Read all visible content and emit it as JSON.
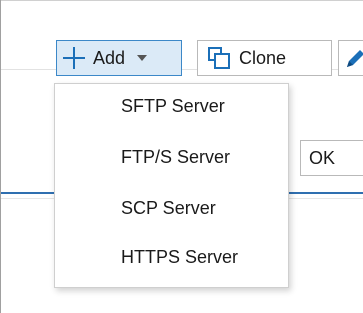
{
  "toolbar": {
    "add_label": "Add",
    "clone_label": "Clone"
  },
  "menu": {
    "items": [
      {
        "label": "SFTP Server"
      },
      {
        "label": "FTP/S Server"
      },
      {
        "label": "SCP Server"
      },
      {
        "label": "HTTPS Server"
      }
    ]
  },
  "dialog": {
    "ok_label": "OK"
  },
  "icons": {
    "add": "plus-icon",
    "clone": "clone-icon",
    "edit": "pencil-icon",
    "dropdown": "chevron-down-icon"
  },
  "colors": {
    "accent": "#1b6fb8",
    "add_button_bg": "#dbeaf7",
    "add_button_border": "#3c88c8",
    "divider_blue": "#2f6fb0"
  }
}
